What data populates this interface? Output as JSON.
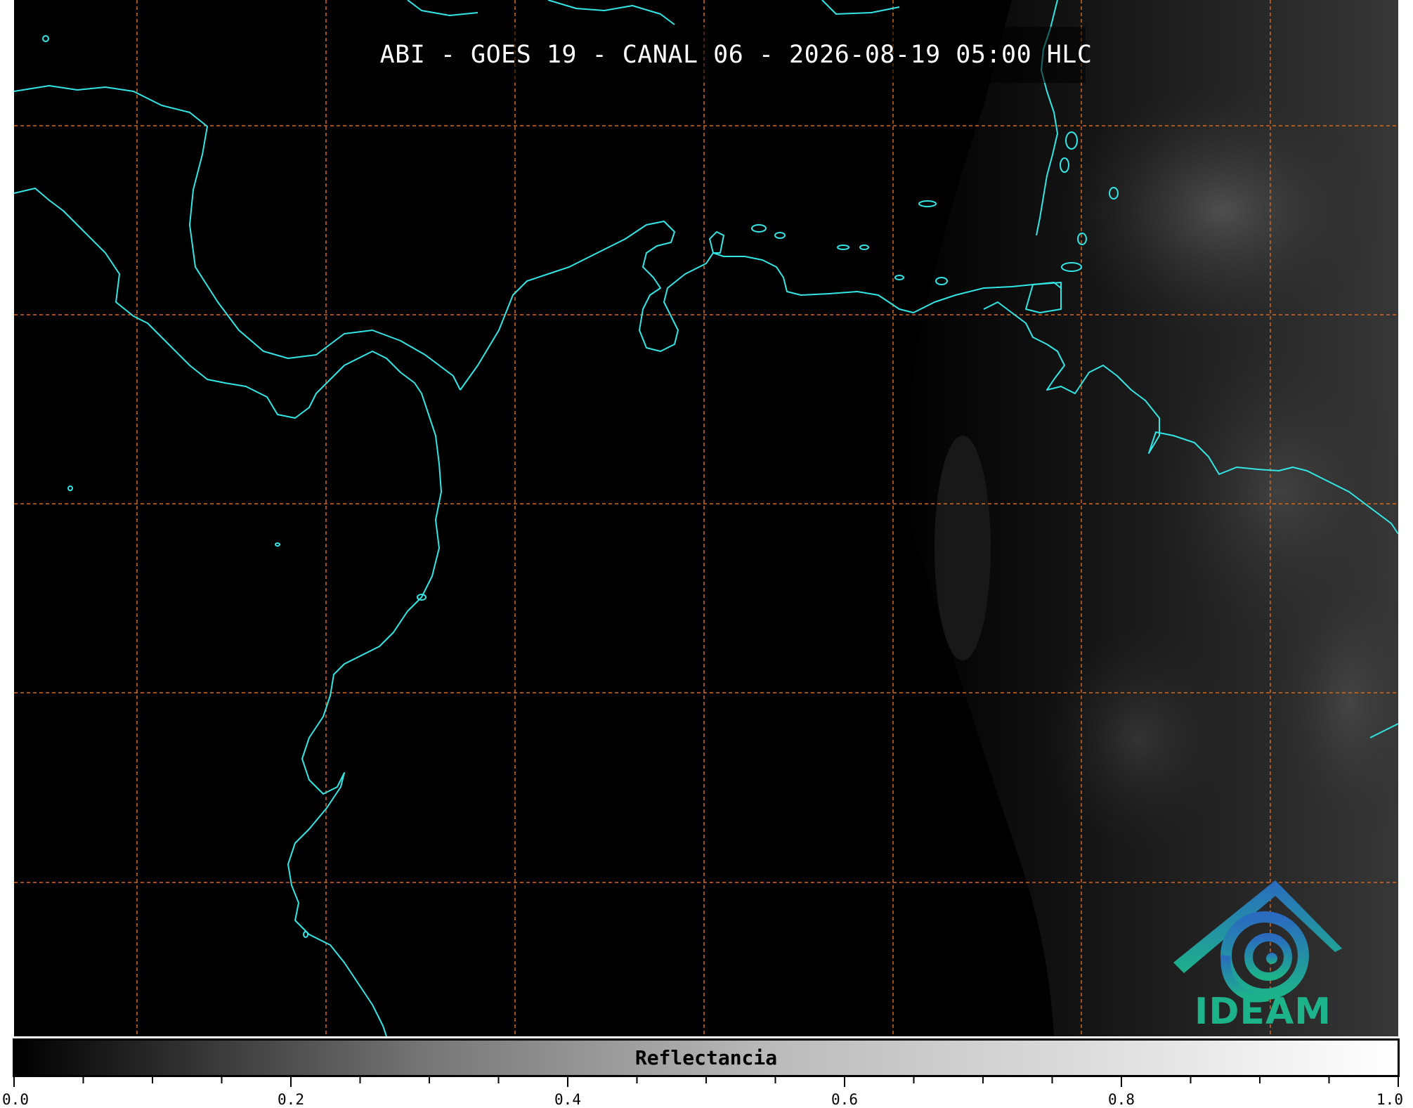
{
  "map": {
    "title": "ABI - GOES 19 - CANAL 06 - 2026-08-19 05:00 HLC",
    "colors": {
      "background": "#000000",
      "coastline": "#33e6e6",
      "gridlines": "#d2691e",
      "cloud_tone": "#3a3a3a"
    },
    "logo": {
      "text": "IDEAM",
      "icon": "ideam-logo-icon"
    }
  },
  "colorbar": {
    "label": "Reflectancia",
    "range": [
      0.0,
      1.0
    ],
    "ticks": [
      "0.0",
      "0.2",
      "0.4",
      "0.6",
      "0.8",
      "1.0"
    ]
  }
}
